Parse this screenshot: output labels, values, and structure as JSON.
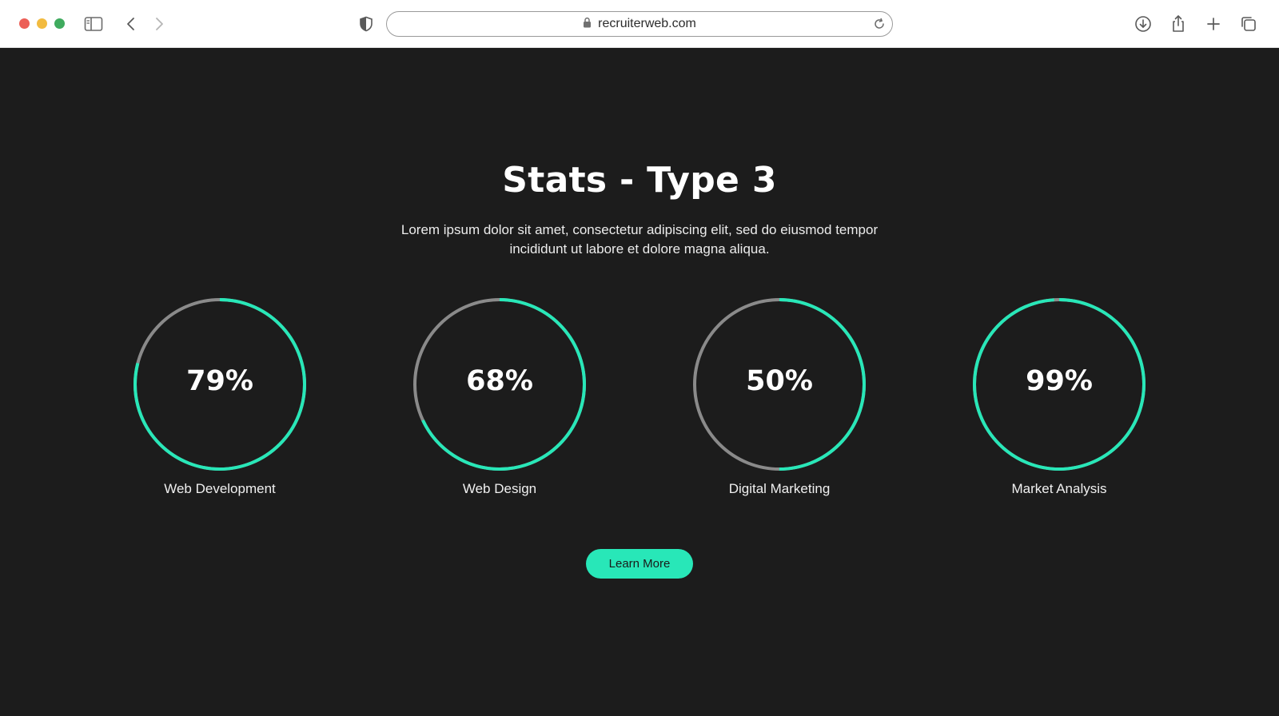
{
  "browser": {
    "url": "recruiterweb.com",
    "icons": [
      "sidebar-icon",
      "back-icon",
      "forward-icon",
      "shield-icon",
      "lock-icon",
      "reload-icon",
      "download-icon",
      "share-icon",
      "new-tab-icon",
      "tabs-icon"
    ]
  },
  "section": {
    "title": "Stats - Type 3",
    "description": "Lorem ipsum dolor sit amet, consectetur adipiscing elit, sed do eiusmod tempor incididunt ut labore et dolore magna aliqua."
  },
  "stats": [
    {
      "percent_label": "79%",
      "value": 79,
      "label": "Web Development"
    },
    {
      "percent_label": "68%",
      "value": 68,
      "label": "Web Design"
    },
    {
      "percent_label": "50%",
      "value": 50,
      "label": "Digital Marketing"
    },
    {
      "percent_label": "99%",
      "value": 99,
      "label": "Market Analysis"
    }
  ],
  "cta": {
    "label": "Learn More"
  },
  "colors": {
    "page_background": "#1c1c1c",
    "accent": "#28e7b8",
    "ring_track": "#8a8a8a",
    "text": "#ffffff"
  }
}
